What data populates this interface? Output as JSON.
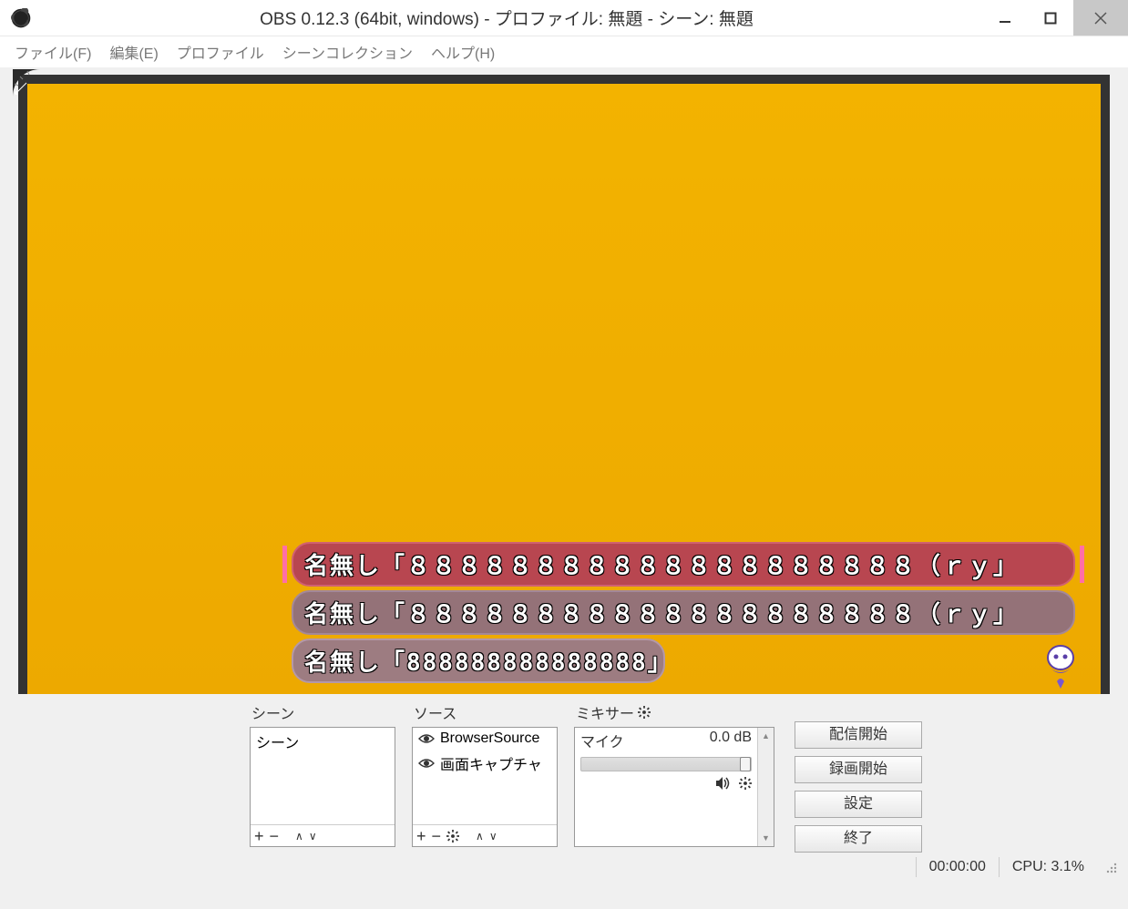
{
  "window": {
    "title": "OBS 0.12.3 (64bit, windows) - プロファイル: 無題 - シーン: 無題"
  },
  "menu": {
    "file": "ファイル(F)",
    "edit": "編集(E)",
    "profile": "プロファイル",
    "scene_collection": "シーンコレクション",
    "help": "ヘルプ(H)"
  },
  "preview": {
    "comments": [
      "名無し「８８８８８８８８８８８８８８８８８８８８（ｒｙ」",
      "名無し「８８８８８８８８８８８８８８８８８８８８（ｒｙ」",
      "名無し「888888888888888」"
    ]
  },
  "panels": {
    "scenes_title": "シーン",
    "scenes": {
      "items": [
        "シーン"
      ]
    },
    "sources_title": "ソース",
    "sources": {
      "items": [
        "BrowserSource",
        "画面キャプチャ"
      ]
    },
    "mixer_title": "ミキサー",
    "mixer": {
      "channel": "マイク",
      "level": "0.0 dB"
    }
  },
  "buttons": {
    "start_stream": "配信開始",
    "start_record": "録画開始",
    "settings": "設定",
    "exit": "終了"
  },
  "status": {
    "time": "00:00:00",
    "cpu": "CPU: 3.1%"
  }
}
